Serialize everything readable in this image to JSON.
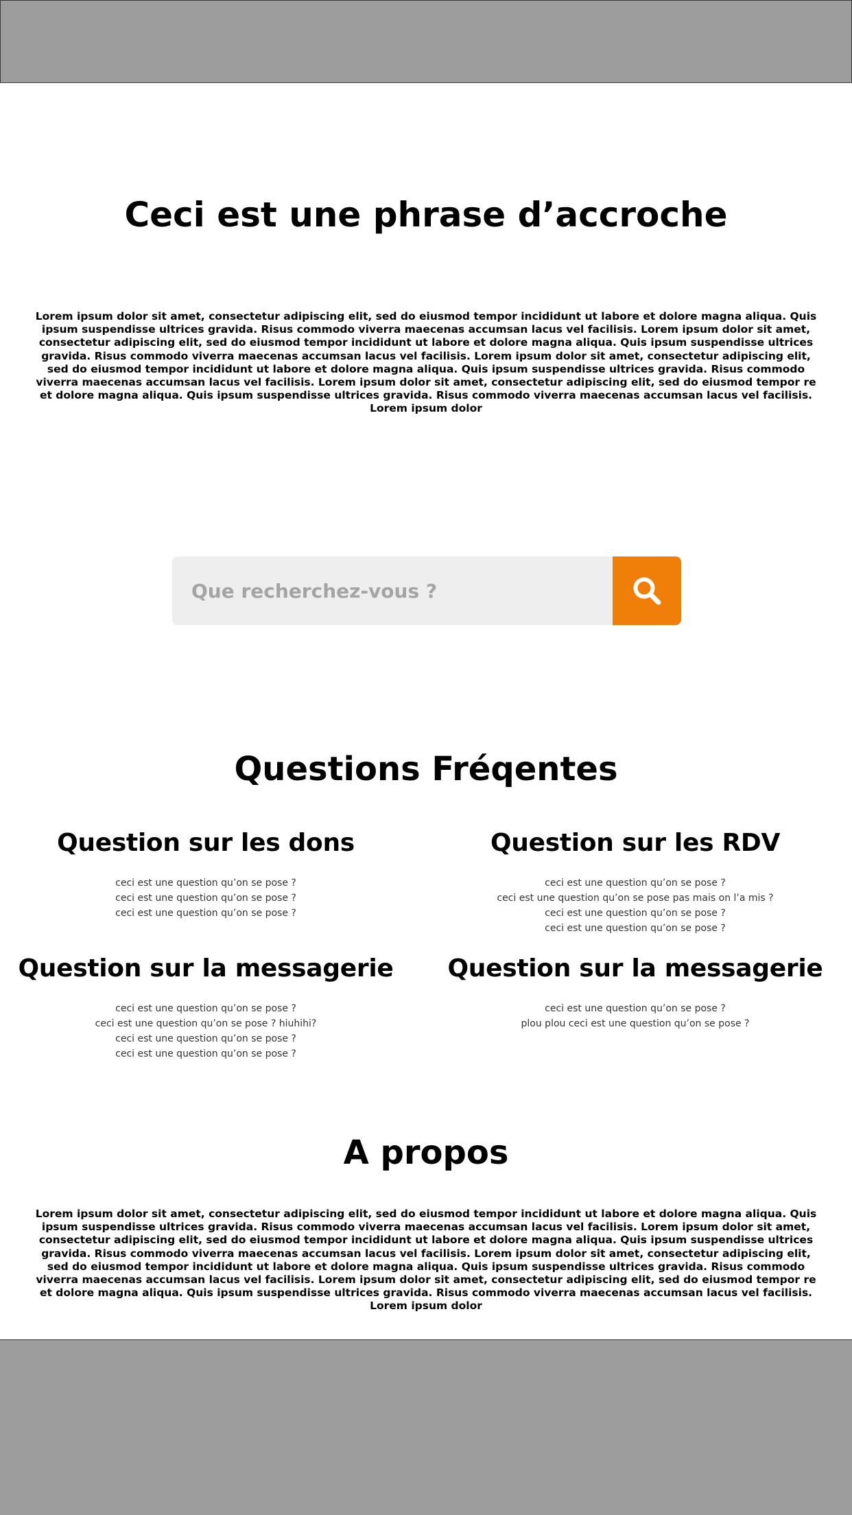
{
  "hero": {
    "title": "Ceci est une phrase d’accroche",
    "text": "Lorem ipsum dolor sit amet, consectetur adipiscing elit, sed do eiusmod tempor incididunt ut labore et dolore magna aliqua. Quis ipsum suspendisse ultrices gravida. Risus commodo viverra maecenas accumsan lacus vel facilisis. Lorem ipsum dolor sit amet, consectetur adipiscing elit, sed do eiusmod tempor incididunt ut labore et dolore magna aliqua. Quis ipsum suspendisse ultrices gravida. Risus commodo viverra maecenas accumsan lacus vel facilisis. Lorem ipsum dolor sit amet, consectetur adipiscing elit, sed do eiusmod tempor incididunt ut labore et dolore magna aliqua. Quis ipsum suspendisse ultrices gravida. Risus commodo viverra maecenas accumsan lacus vel facilisis. Lorem ipsum dolor sit amet, consectetur adipiscing elit, sed do eiusmod tempor re et dolore magna aliqua. Quis ipsum suspendisse ultrices gravida. Risus commodo viverra maecenas accumsan lacus vel facilisis. Lorem ipsum dolor"
  },
  "search": {
    "placeholder": "Que recherchez-vous ?",
    "value": "",
    "button_icon": "search-icon"
  },
  "faq": {
    "title": "Questions Fréqentes",
    "groups": [
      {
        "title": "Question sur les dons",
        "questions": [
          "ceci est une question qu’on se pose ?",
          "ceci est une question qu’on se pose ?",
          "ceci est une question qu’on se pose ?"
        ]
      },
      {
        "title": "Question sur les RDV",
        "questions": [
          "ceci est une question qu’on se pose ?",
          "ceci est une question qu’on se pose pas mais on l’a mis ?",
          "ceci est une question qu’on se pose ?",
          "ceci est une question qu’on se pose ?"
        ]
      },
      {
        "title": "Question sur la messagerie",
        "questions": [
          "ceci est une question qu’on se pose ?",
          "ceci est une question qu’on se pose ? hiuhihi?",
          "ceci est une question qu’on se pose ?",
          "ceci est une question qu’on se pose ?"
        ]
      },
      {
        "title": "Question sur la messagerie",
        "questions": [
          "ceci est une question qu’on se pose ?",
          "plou plou ceci est une question qu’on se pose ?"
        ]
      }
    ]
  },
  "about": {
    "title": "A propos",
    "text": "Lorem ipsum dolor sit amet, consectetur adipiscing elit, sed do eiusmod tempor incididunt ut labore et dolore magna aliqua. Quis ipsum suspendisse ultrices gravida. Risus commodo viverra maecenas accumsan lacus vel facilisis. Lorem ipsum dolor sit amet, consectetur adipiscing elit, sed do eiusmod tempor incididunt ut labore et dolore magna aliqua. Quis ipsum suspendisse ultrices gravida. Risus commodo viverra maecenas accumsan lacus vel facilisis. Lorem ipsum dolor sit amet, consectetur adipiscing elit, sed do eiusmod tempor incididunt ut labore et dolore magna aliqua. Quis ipsum suspendisse ultrices gravida. Risus commodo viverra maecenas accumsan lacus vel facilisis. Lorem ipsum dolor sit amet, consectetur adipiscing elit, sed do eiusmod tempor re et dolore magna aliqua. Quis ipsum suspendisse ultrices gravida. Risus commodo viverra maecenas accumsan lacus vel facilisis. Lorem ipsum dolor"
  },
  "colors": {
    "accent": "#f07f0a",
    "placeholder_bar": "#9d9d9d",
    "search_bg": "#eeeeee"
  }
}
